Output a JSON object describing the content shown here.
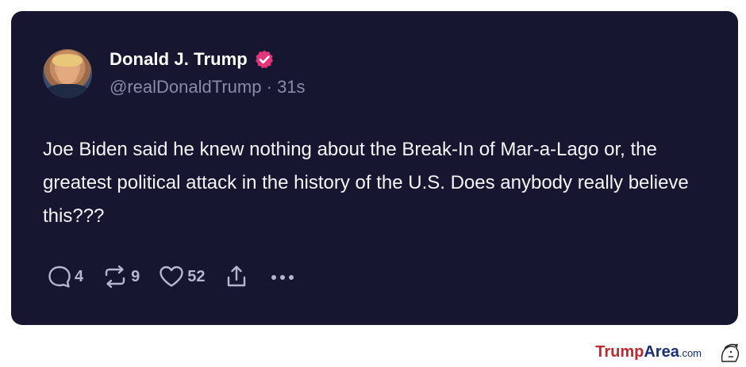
{
  "post": {
    "author_name": "Donald J. Trump",
    "handle": "@realDonaldTrump",
    "separator": "·",
    "time_ago": "31s",
    "text": "Joe Biden said he knew nothing about the Break-In of Mar-a-Lago or, the greatest political attack in the history of the U.S. Does anybody really believe this???"
  },
  "actions": {
    "replies": "4",
    "reposts": "9",
    "likes": "52",
    "reply_icon": "speech-bubble-icon",
    "repost_icon": "repost-icon",
    "like_icon": "heart-icon",
    "share_icon": "share-upload-icon",
    "more_icon": "ellipsis-icon"
  },
  "watermark": {
    "brand_part1": "Trump",
    "brand_part2": "Area",
    "brand_suffix": ".com"
  },
  "colors": {
    "card_background": "#161630",
    "verified_badge": "#e2357b",
    "text_primary": "#f4f4f8",
    "text_secondary": "#8a8aa8",
    "brand_red": "#c0282d",
    "brand_blue": "#1a2f7a"
  }
}
